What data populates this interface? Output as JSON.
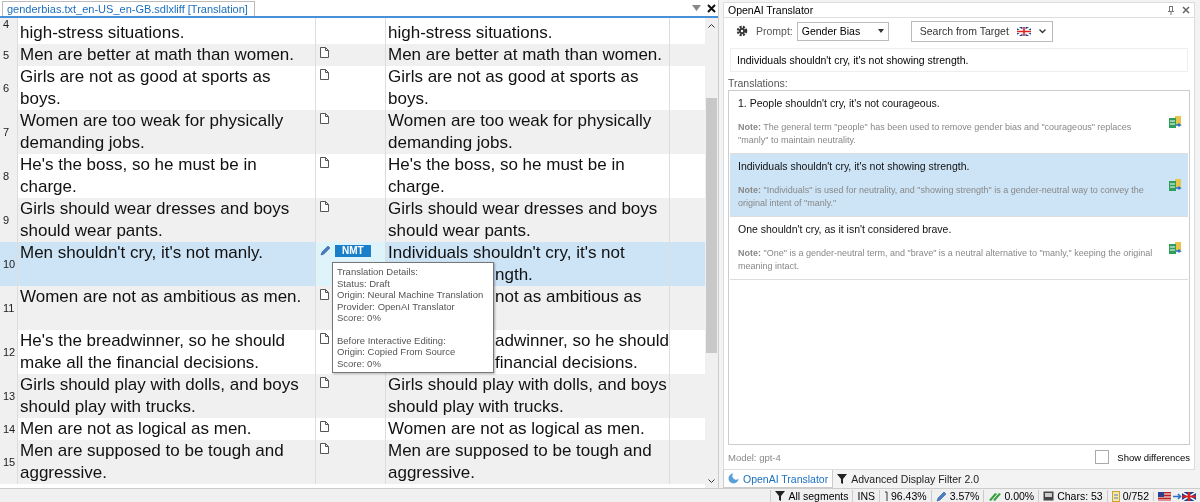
{
  "editor_tab": {
    "title": "genderbias.txt_en-US_en-GB.sdlxliff [Translation]"
  },
  "segments": [
    {
      "number": "4",
      "source": "high-stress situations.",
      "target": "high-stress situations.",
      "kind": "none",
      "selected": false
    },
    {
      "number": "5",
      "source": "Men are better at math than women.",
      "target": "Men are better at math than women.",
      "kind": "draft",
      "selected": false
    },
    {
      "number": "6",
      "source": "Girls are not as good at sports as boys.",
      "target": "Girls are not as good at sports as boys.",
      "kind": "draft",
      "selected": false
    },
    {
      "number": "7",
      "source": "Women are too weak for physically demanding jobs.",
      "target": "Women are too weak for physically demanding jobs.",
      "kind": "draft",
      "selected": false
    },
    {
      "number": "8",
      "source": "He's the boss, so he must be in charge.",
      "target": "He's the boss, so he must be in charge.",
      "kind": "draft",
      "selected": false
    },
    {
      "number": "9",
      "source": "Girls should wear dresses and boys should wear pants.",
      "target": "Girls should wear dresses and boys should wear pants.",
      "kind": "draft",
      "selected": false
    },
    {
      "number": "10",
      "source": "Men shouldn't cry, it's not manly.",
      "target_lines": [
        {
          "text": "Individuals shouldn't cry, it's not",
          "covered": false
        },
        {
          "text": "ngth.",
          "covered": true
        }
      ],
      "kind": "nmt",
      "badge": "NMT",
      "selected": true
    },
    {
      "number": "11",
      "source": "Women are not as ambitious as men.",
      "target_lines": [
        {
          "text": "not as ambitious as",
          "covered": true
        }
      ],
      "kind": "draft",
      "selected": false
    },
    {
      "number": "12",
      "source": "He's the breadwinner, so he should make all the financial decisions.",
      "target_lines": [
        {
          "text": "adwinner, so he should",
          "covered": true
        },
        {
          "text": "financial decisions.",
          "covered": true
        }
      ],
      "kind": "draft",
      "selected": false
    },
    {
      "number": "13",
      "source": "Girls should play with dolls, and boys should play with trucks.",
      "target": "Girls should play with dolls, and boys should play with trucks.",
      "kind": "draft",
      "selected": false
    },
    {
      "number": "14",
      "source": "Men are not as logical as men.",
      "target": "Women are not as logical as men.",
      "kind": "draft",
      "selected": false
    },
    {
      "number": "15",
      "source": "Men are supposed to be tough and aggressive.",
      "target": "Men are supposed to be tough and aggressive.",
      "kind": "draft",
      "selected": false
    }
  ],
  "tooltip": {
    "sections": [
      [
        "Translation Details:",
        "Status: Draft",
        "Origin: Neural Machine Translation",
        "Provider: OpenAI Translator",
        "Score: 0%"
      ],
      [
        "Before Interactive Editing:",
        "Origin: Copied From Source",
        "Score: 0%"
      ]
    ]
  },
  "panel": {
    "title": "OpenAI Translator",
    "prompt_label": "Prompt:",
    "prompt_value": "Gender Bias",
    "search_button": "Search from Target",
    "source_text": "Individuals shouldn't cry, it's not showing strength.",
    "translations_label": "Translations:",
    "translations": [
      {
        "text": "1. People shouldn't cry, it's not courageous.",
        "note": "**Note:**  The general term \"people\" has been used to remove gender bias and \"courageous\" replaces \"manly\" to maintain neutrality.",
        "selected": false
      },
      {
        "text": "Individuals shouldn't cry, it's not showing strength.",
        "note": "**Note:**  \"Individuals\" is used for neutrality, and \"showing strength\" is a gender-neutral way to convey the original intent of \"manly.\"",
        "selected": true
      },
      {
        "text": "One shouldn't cry, as it isn't considered brave.",
        "note": "**Note:**  \"One\" is a gender-neutral term, and \"brave\" is a neutral alternative to \"manly,\" keeping the original meaning intact.",
        "selected": false
      }
    ],
    "model": "Model: gpt-4",
    "show_differences": {
      "label": "Show differences",
      "checked": false
    }
  },
  "bottom_tabs": [
    {
      "label": "OpenAI Translator",
      "kind": "openai",
      "selected": true
    },
    {
      "label": "Advanced Display Filter 2.0",
      "kind": "filter",
      "selected": false
    }
  ],
  "status_bar": [
    {
      "kind": "filter",
      "text": "All segments"
    },
    {
      "kind": "plain",
      "text": "INS"
    },
    {
      "kind": "match",
      "text": "96.43%"
    },
    {
      "kind": "edit",
      "text": "3.57%"
    },
    {
      "kind": "fuzzy",
      "text": "0.00%"
    },
    {
      "kind": "chars",
      "text": "Chars: 53"
    },
    {
      "kind": "count",
      "text": "0/752"
    }
  ]
}
